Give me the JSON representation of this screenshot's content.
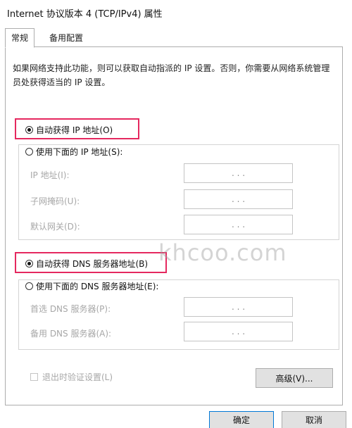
{
  "window": {
    "title": "Internet 协议版本 4 (TCP/IPv4) 属性"
  },
  "tabs": [
    {
      "label": "常规",
      "active": true
    },
    {
      "label": "备用配置",
      "active": false
    }
  ],
  "description": "如果网络支持此功能，则可以获取自动指派的 IP 设置。否则，你需要从网络系统管理员处获得适当的 IP 设置。",
  "ip": {
    "auto_label": "自动获得 IP 地址(O)",
    "auto_selected": true,
    "manual_label": "使用下面的 IP 地址(S):",
    "fields": [
      {
        "label": "IP 地址(I):",
        "value": ".   .   ."
      },
      {
        "label": "子网掩码(U):",
        "value": ".   .   ."
      },
      {
        "label": "默认网关(D):",
        "value": ".   .   ."
      }
    ]
  },
  "dns": {
    "auto_label": "自动获得 DNS 服务器地址(B)",
    "auto_selected": true,
    "manual_label": "使用下面的 DNS 服务器地址(E):",
    "fields": [
      {
        "label": "首选 DNS 服务器(P):",
        "value": ".   .   ."
      },
      {
        "label": "备用 DNS 服务器(A):",
        "value": ".   .   ."
      }
    ]
  },
  "validate_on_exit": {
    "label": "退出时验证设置(L)",
    "checked": false,
    "enabled": false
  },
  "buttons": {
    "advanced": "高级(V)...",
    "ok": "确定",
    "cancel": "取消"
  },
  "watermark": "khcoo.com",
  "colors": {
    "highlight": "#e5285f",
    "disabled_text": "#a7a7a7",
    "button_bg": "#e1e1e1"
  }
}
